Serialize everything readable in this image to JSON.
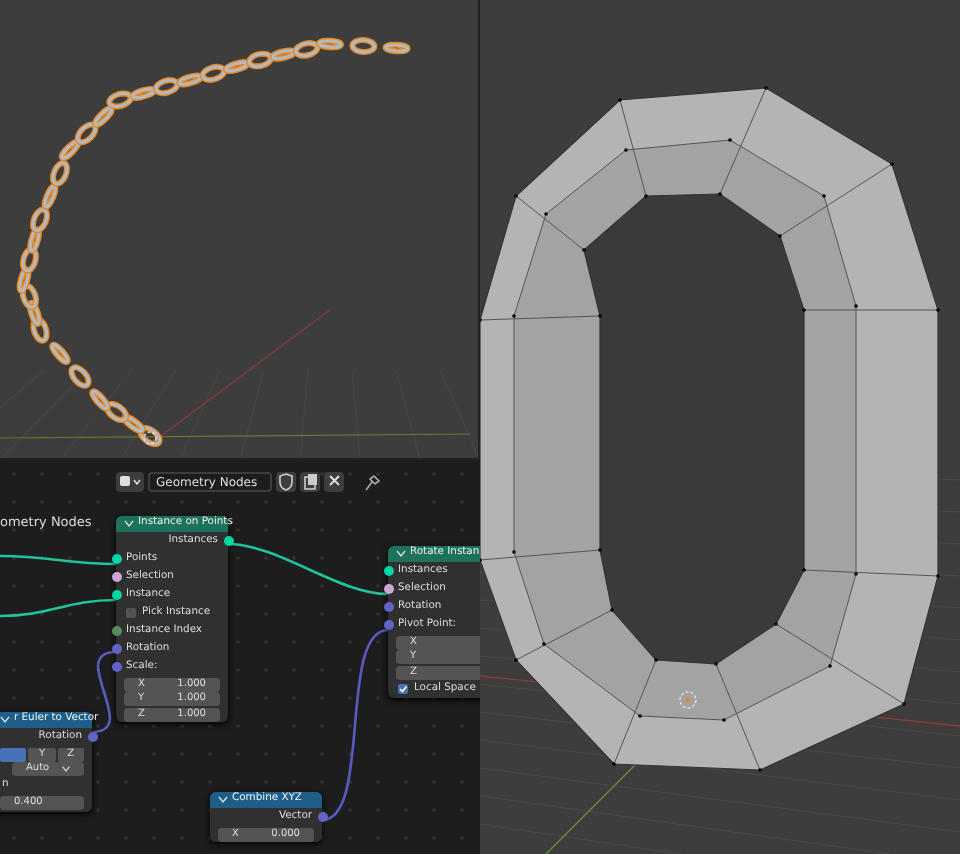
{
  "node_editor": {
    "editor_header": {
      "node_tree_name": "Geometry Nodes"
    },
    "breadcrumb": "ometry Nodes",
    "nodes": [
      {
        "title": "Instance on Points",
        "color": "#1d725e",
        "rows": [
          {
            "kind": "output",
            "label": "Instances",
            "color": "#00d6a3"
          },
          {
            "kind": "input",
            "label": "Points",
            "color": "#00d6a3"
          },
          {
            "kind": "input",
            "label": "Selection",
            "color": "#cca6d6"
          },
          {
            "kind": "input",
            "label": "Instance",
            "color": "#00d6a3"
          },
          {
            "kind": "checkbox",
            "label": "Pick Instance",
            "checked": false
          },
          {
            "kind": "input",
            "label": "Instance Index",
            "color": "#598c5c"
          },
          {
            "kind": "input",
            "label": "Rotation",
            "color": "#6363c7"
          },
          {
            "kind": "input",
            "label": "Scale:",
            "color": "#6363c7"
          },
          {
            "kind": "field",
            "label": "X",
            "value": "1.000"
          },
          {
            "kind": "field",
            "label": "Y",
            "value": "1.000"
          },
          {
            "kind": "field",
            "label": "Z",
            "value": "1.000"
          }
        ]
      },
      {
        "title": "Rotate Instan",
        "color": "#1d725e",
        "rows": [
          {
            "kind": "input",
            "label": "Instances",
            "color": "#00d6a3"
          },
          {
            "kind": "input",
            "label": "Selection",
            "color": "#cca6d6"
          },
          {
            "kind": "input",
            "label": "Rotation",
            "color": "#6363c7"
          },
          {
            "kind": "input",
            "label": "Pivot Point:",
            "color": "#6363c7"
          },
          {
            "kind": "field",
            "label": "X"
          },
          {
            "kind": "field",
            "label": "Y"
          },
          {
            "kind": "field",
            "label": "Z"
          },
          {
            "kind": "checkbox",
            "label": "Local Space",
            "checked": true
          }
        ]
      },
      {
        "title": "r Euler to Vector",
        "color": "#1e5f8a",
        "rows": [
          {
            "kind": "output",
            "label": "Rotation",
            "color": "#6363c7"
          },
          {
            "kind": "segmented",
            "options": [
              {
                "selected": true
              },
              {
                "label": "Y",
                "selected": false
              },
              {
                "label": "Z",
                "selected": false
              }
            ]
          },
          {
            "kind": "dropdown",
            "value": "Auto"
          },
          {
            "kind": "label",
            "label": "n"
          },
          {
            "kind": "field",
            "value": "0.400"
          }
        ]
      },
      {
        "title": "Combine XYZ",
        "color": "#1e5f8a",
        "rows": [
          {
            "kind": "output",
            "label": "Vector",
            "color": "#6363c7"
          },
          {
            "kind": "field",
            "label": "X",
            "value": "0.000"
          }
        ]
      }
    ]
  }
}
